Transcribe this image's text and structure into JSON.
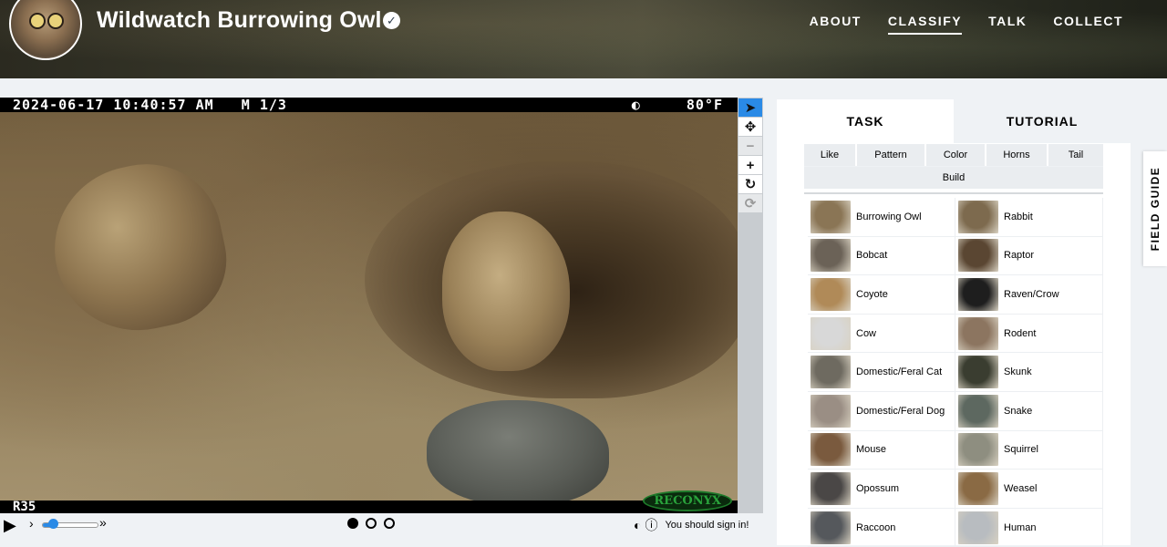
{
  "project": {
    "title": "Wildwatch Burrowing Owl",
    "verified_icon": "check-badge-icon"
  },
  "nav": [
    {
      "label": "ABOUT",
      "active": false
    },
    {
      "label": "CLASSIFY",
      "active": true
    },
    {
      "label": "TALK",
      "active": false
    },
    {
      "label": "COLLECT",
      "active": false
    }
  ],
  "camera": {
    "timestamp": "2024-06-17 10:40:57 AM",
    "frame": "M 1/3",
    "moon_icon": "moon-phase-icon",
    "temperature": "80°F",
    "camera_id": "R35",
    "brand": "RECONYX"
  },
  "tools": [
    "pointer-icon",
    "move-icon",
    "zoom-out-icon",
    "zoom-in-icon",
    "rotate-icon",
    "reset-icon"
  ],
  "playback": {
    "speed_level": 0.2,
    "frames_total": 3,
    "frame_current": 1,
    "signin_text": "You should sign in!"
  },
  "task_panel": {
    "tabs": [
      {
        "label": "TASK",
        "active": true
      },
      {
        "label": "TUTORIAL",
        "active": false
      }
    ],
    "filters_row1": [
      "Like",
      "Pattern",
      "Color",
      "Horns",
      "Tail"
    ],
    "filters_row2": [
      "Build"
    ],
    "choices": [
      {
        "label": "Burrowing Owl",
        "color": "#8a7555"
      },
      {
        "label": "Rabbit",
        "color": "#7d6a4e"
      },
      {
        "label": "Bobcat",
        "color": "#6b6257"
      },
      {
        "label": "Raptor",
        "color": "#5a4632"
      },
      {
        "label": "Coyote",
        "color": "#b08a58"
      },
      {
        "label": "Raven/Crow",
        "color": "#1e1e1e"
      },
      {
        "label": "Cow",
        "color": "#d8d8d8"
      },
      {
        "label": "Rodent",
        "color": "#8c7560"
      },
      {
        "label": "Domestic/Feral Cat",
        "color": "#6e6a60"
      },
      {
        "label": "Skunk",
        "color": "#3a3d30"
      },
      {
        "label": "Domestic/Feral Dog",
        "color": "#9a8e84"
      },
      {
        "label": "Snake",
        "color": "#5d6860"
      },
      {
        "label": "Mouse",
        "color": "#7a5a3e"
      },
      {
        "label": "Squirrel",
        "color": "#8e8e80"
      },
      {
        "label": "Opossum",
        "color": "#4a4746"
      },
      {
        "label": "Weasel",
        "color": "#8a6a44"
      },
      {
        "label": "Raccoon",
        "color": "#55585c"
      },
      {
        "label": "Human",
        "color": "#b8bcc0"
      }
    ]
  },
  "field_guide": {
    "label": "FIELD GUIDE"
  }
}
